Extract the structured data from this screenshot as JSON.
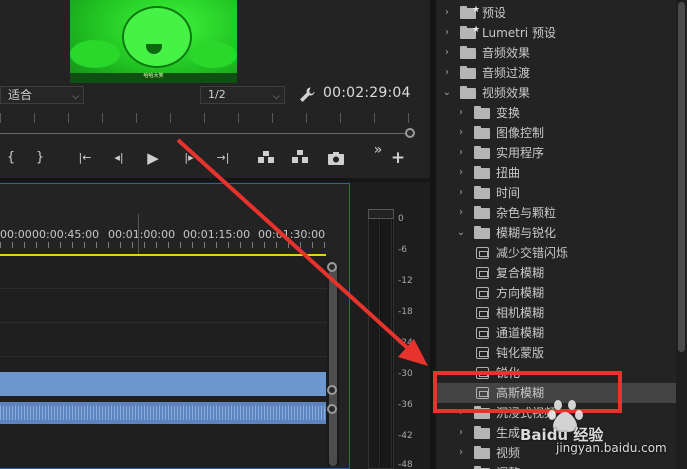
{
  "monitor": {
    "preview_caption": "哈哈大笑",
    "fit_value": "适合",
    "resolution_value": "1/2",
    "timecode": "00:02:29:04",
    "transport": {
      "mark_in": "{",
      "mark_out": "}",
      "go_to_in": "|←",
      "step_back": "◂|",
      "play": "▶",
      "step_forward": "|▸",
      "go_to_out": "→|",
      "export_frame": "camera",
      "more": "»",
      "add": "+"
    }
  },
  "timeline": {
    "ruler_labels": [
      "00:00",
      "00:00:45:00",
      "00:01:00:00",
      "00:01:15:00",
      "00:01:30:00"
    ]
  },
  "meter": {
    "labels": [
      "0",
      "-6",
      "-12",
      "-18",
      "-24",
      "-30",
      "-36",
      "-42",
      "-48"
    ]
  },
  "effects": {
    "items": [
      {
        "label": "预设",
        "kind": "folder-star",
        "expanded": false,
        "level": 0
      },
      {
        "label": "Lumetri 预设",
        "kind": "folder-star",
        "expanded": false,
        "level": 0
      },
      {
        "label": "音频效果",
        "kind": "folder",
        "expanded": false,
        "level": 0
      },
      {
        "label": "音频过渡",
        "kind": "folder",
        "expanded": false,
        "level": 0
      },
      {
        "label": "视频效果",
        "kind": "folder",
        "expanded": true,
        "level": 0
      },
      {
        "label": "变换",
        "kind": "folder",
        "expanded": false,
        "level": 1
      },
      {
        "label": "图像控制",
        "kind": "folder",
        "expanded": false,
        "level": 1
      },
      {
        "label": "实用程序",
        "kind": "folder",
        "expanded": false,
        "level": 1
      },
      {
        "label": "扭曲",
        "kind": "folder",
        "expanded": false,
        "level": 1
      },
      {
        "label": "时间",
        "kind": "folder",
        "expanded": false,
        "level": 1
      },
      {
        "label": "杂色与颗粒",
        "kind": "folder",
        "expanded": false,
        "level": 1
      },
      {
        "label": "模糊与锐化",
        "kind": "folder",
        "expanded": true,
        "level": 1
      },
      {
        "label": "减少交错闪烁",
        "kind": "effect",
        "level": 2
      },
      {
        "label": "复合模糊",
        "kind": "effect",
        "level": 2
      },
      {
        "label": "方向模糊",
        "kind": "effect",
        "level": 2
      },
      {
        "label": "相机模糊",
        "kind": "effect",
        "level": 2
      },
      {
        "label": "通道模糊",
        "kind": "effect",
        "level": 2
      },
      {
        "label": "钝化蒙版",
        "kind": "effect",
        "level": 2
      },
      {
        "label": "锐化",
        "kind": "effect",
        "level": 2
      },
      {
        "label": "高斯模糊",
        "kind": "effect",
        "level": 2,
        "selected": true
      },
      {
        "label": "沉浸式视频",
        "kind": "folder",
        "expanded": false,
        "level": 1
      },
      {
        "label": "生成",
        "kind": "folder",
        "expanded": false,
        "level": 1
      },
      {
        "label": "视频",
        "kind": "folder",
        "expanded": false,
        "level": 1
      },
      {
        "label": "调整",
        "kind": "folder",
        "expanded": false,
        "level": 1
      }
    ]
  },
  "annotation": {
    "arrow_color": "#e8322c",
    "box_color": "#e8322c"
  },
  "watermark": {
    "brand": "Baidu 经验",
    "url": "jingyan.baidu.com"
  },
  "colors": {
    "preview_tint": "#19c41d",
    "work_area": "#e0d51b",
    "video_clip": "#6d98cf",
    "audio_clip": "#5c84bf",
    "selection": "#444444"
  }
}
